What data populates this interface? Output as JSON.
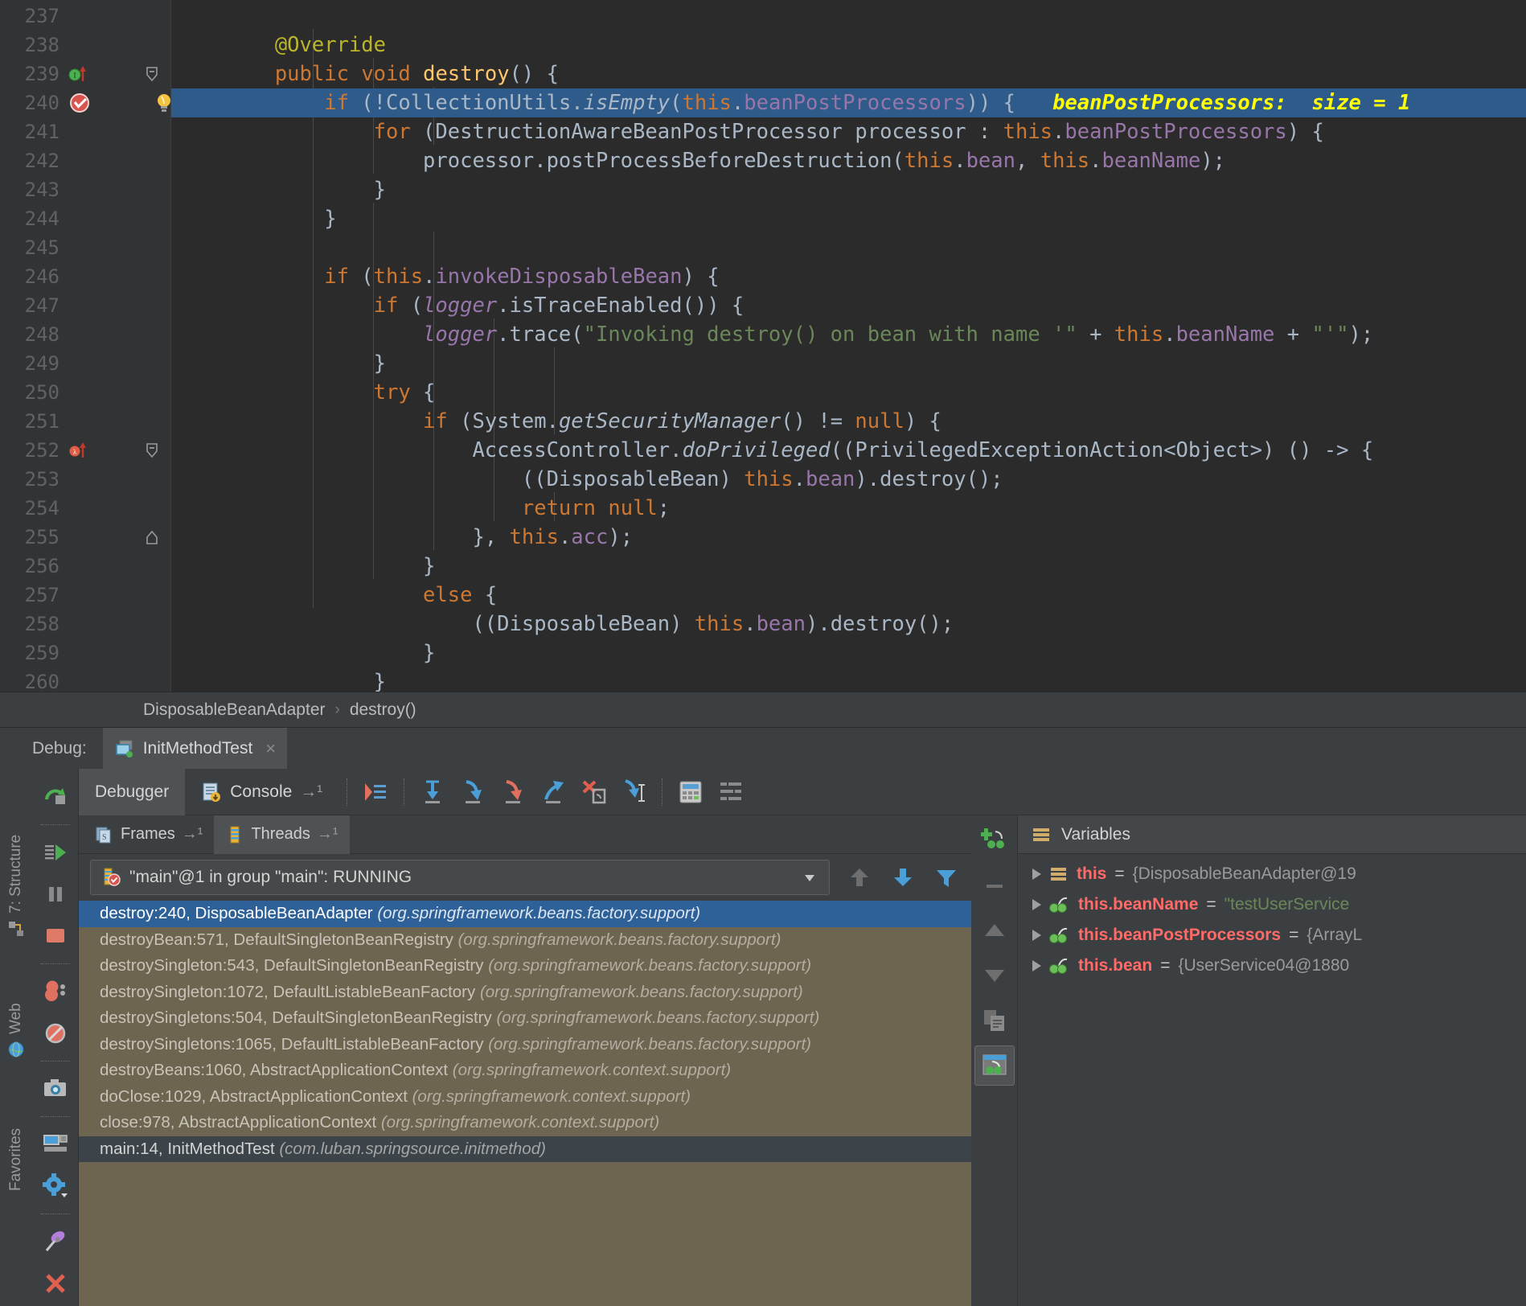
{
  "editor": {
    "first_line": 237,
    "highlight_line": 240,
    "inline_hint": "beanPostProcessors:  size = 1",
    "lines": [
      {
        "n": 237,
        "tokens": []
      },
      {
        "n": 238,
        "tokens": [
          {
            "t": "        ",
            "c": "pln"
          },
          {
            "t": "@Override",
            "c": "ann"
          }
        ]
      },
      {
        "n": 239,
        "tokens": [
          {
            "t": "        ",
            "c": "pln"
          },
          {
            "t": "public",
            "c": "kw"
          },
          {
            "t": " ",
            "c": "pln"
          },
          {
            "t": "void",
            "c": "kw"
          },
          {
            "t": " ",
            "c": "pln"
          },
          {
            "t": "destroy",
            "c": "mth"
          },
          {
            "t": "() {",
            "c": "pln"
          }
        ]
      },
      {
        "n": 240,
        "tokens": [
          {
            "t": "            ",
            "c": "pln"
          },
          {
            "t": "if",
            "c": "kw"
          },
          {
            "t": " (!CollectionUtils.",
            "c": "pln"
          },
          {
            "t": "isEmpty",
            "c": "pln ital"
          },
          {
            "t": "(",
            "c": "pln"
          },
          {
            "t": "this",
            "c": "kw"
          },
          {
            "t": ".",
            "c": "pln"
          },
          {
            "t": "beanPostProcessors",
            "c": "fld"
          },
          {
            "t": ")) {",
            "c": "pln"
          }
        ]
      },
      {
        "n": 241,
        "tokens": [
          {
            "t": "                ",
            "c": "pln"
          },
          {
            "t": "for",
            "c": "kw"
          },
          {
            "t": " (DestructionAwareBeanPostProcessor processor : ",
            "c": "pln"
          },
          {
            "t": "this",
            "c": "kw"
          },
          {
            "t": ".",
            "c": "pln"
          },
          {
            "t": "beanPostProcessors",
            "c": "fld"
          },
          {
            "t": ") {",
            "c": "pln"
          }
        ]
      },
      {
        "n": 242,
        "tokens": [
          {
            "t": "                    processor.postProcessBeforeDestruction(",
            "c": "pln"
          },
          {
            "t": "this",
            "c": "kw"
          },
          {
            "t": ".",
            "c": "pln"
          },
          {
            "t": "bean",
            "c": "fld"
          },
          {
            "t": ", ",
            "c": "pln"
          },
          {
            "t": "this",
            "c": "kw"
          },
          {
            "t": ".",
            "c": "pln"
          },
          {
            "t": "beanName",
            "c": "fld"
          },
          {
            "t": ");",
            "c": "pln"
          }
        ]
      },
      {
        "n": 243,
        "tokens": [
          {
            "t": "                }",
            "c": "pln"
          }
        ]
      },
      {
        "n": 244,
        "tokens": [
          {
            "t": "            }",
            "c": "pln"
          }
        ]
      },
      {
        "n": 245,
        "tokens": []
      },
      {
        "n": 246,
        "tokens": [
          {
            "t": "            ",
            "c": "pln"
          },
          {
            "t": "if",
            "c": "kw"
          },
          {
            "t": " (",
            "c": "pln"
          },
          {
            "t": "this",
            "c": "kw"
          },
          {
            "t": ".",
            "c": "pln"
          },
          {
            "t": "invokeDisposableBean",
            "c": "fld"
          },
          {
            "t": ") {",
            "c": "pln"
          }
        ]
      },
      {
        "n": 247,
        "tokens": [
          {
            "t": "                ",
            "c": "pln"
          },
          {
            "t": "if",
            "c": "kw"
          },
          {
            "t": " (",
            "c": "pln"
          },
          {
            "t": "logger",
            "c": "fld ital"
          },
          {
            "t": ".isTraceEnabled()) {",
            "c": "pln"
          }
        ]
      },
      {
        "n": 248,
        "tokens": [
          {
            "t": "                    ",
            "c": "pln"
          },
          {
            "t": "logger",
            "c": "fld ital"
          },
          {
            "t": ".trace(",
            "c": "pln"
          },
          {
            "t": "\"Invoking destroy() on bean with name '\"",
            "c": "str"
          },
          {
            "t": " + ",
            "c": "pln"
          },
          {
            "t": "this",
            "c": "kw"
          },
          {
            "t": ".",
            "c": "pln"
          },
          {
            "t": "beanName",
            "c": "fld"
          },
          {
            "t": " + ",
            "c": "pln"
          },
          {
            "t": "\"'\"",
            "c": "str"
          },
          {
            "t": ");",
            "c": "pln"
          }
        ]
      },
      {
        "n": 249,
        "tokens": [
          {
            "t": "                }",
            "c": "pln"
          }
        ]
      },
      {
        "n": 250,
        "tokens": [
          {
            "t": "                ",
            "c": "pln"
          },
          {
            "t": "try",
            "c": "kw"
          },
          {
            "t": " {",
            "c": "pln"
          }
        ]
      },
      {
        "n": 251,
        "tokens": [
          {
            "t": "                    ",
            "c": "pln"
          },
          {
            "t": "if",
            "c": "kw"
          },
          {
            "t": " (System.",
            "c": "pln"
          },
          {
            "t": "getSecurityManager",
            "c": "pln ital"
          },
          {
            "t": "() != ",
            "c": "pln"
          },
          {
            "t": "null",
            "c": "kw"
          },
          {
            "t": ") {",
            "c": "pln"
          }
        ]
      },
      {
        "n": 252,
        "tokens": [
          {
            "t": "                        AccessController.",
            "c": "pln"
          },
          {
            "t": "doPrivileged",
            "c": "pln ital"
          },
          {
            "t": "((PrivilegedExceptionAction<Object>) () -> {",
            "c": "pln"
          }
        ]
      },
      {
        "n": 253,
        "tokens": [
          {
            "t": "                            ((DisposableBean) ",
            "c": "pln"
          },
          {
            "t": "this",
            "c": "kw"
          },
          {
            "t": ".",
            "c": "pln"
          },
          {
            "t": "bean",
            "c": "fld"
          },
          {
            "t": ").destroy();",
            "c": "pln"
          }
        ]
      },
      {
        "n": 254,
        "tokens": [
          {
            "t": "                            ",
            "c": "pln"
          },
          {
            "t": "return",
            "c": "kw"
          },
          {
            "t": " ",
            "c": "pln"
          },
          {
            "t": "null",
            "c": "kw"
          },
          {
            "t": ";",
            "c": "pln"
          }
        ]
      },
      {
        "n": 255,
        "tokens": [
          {
            "t": "                        }, ",
            "c": "pln"
          },
          {
            "t": "this",
            "c": "kw"
          },
          {
            "t": ".",
            "c": "pln"
          },
          {
            "t": "acc",
            "c": "fld"
          },
          {
            "t": ");",
            "c": "pln"
          }
        ]
      },
      {
        "n": 256,
        "tokens": [
          {
            "t": "                    }",
            "c": "pln"
          }
        ]
      },
      {
        "n": 257,
        "tokens": [
          {
            "t": "                    ",
            "c": "pln"
          },
          {
            "t": "else",
            "c": "kw"
          },
          {
            "t": " {",
            "c": "pln"
          }
        ]
      },
      {
        "n": 258,
        "tokens": [
          {
            "t": "                        ((DisposableBean) ",
            "c": "pln"
          },
          {
            "t": "this",
            "c": "kw"
          },
          {
            "t": ".",
            "c": "pln"
          },
          {
            "t": "bean",
            "c": "fld"
          },
          {
            "t": ").destroy();",
            "c": "pln"
          }
        ]
      },
      {
        "n": 259,
        "tokens": [
          {
            "t": "                    }",
            "c": "pln"
          }
        ]
      },
      {
        "n": 260,
        "tokens": [
          {
            "t": "                }",
            "c": "pln"
          }
        ]
      }
    ]
  },
  "breadcrumb": {
    "class": "DisposableBeanAdapter",
    "separator": "›",
    "method": "destroy()"
  },
  "debug_header": {
    "label": "Debug:",
    "run_config": "InitMethodTest",
    "close": "×"
  },
  "debug_toolbar": {
    "tabs": [
      {
        "label": "Debugger",
        "active": true
      },
      {
        "label": "Console",
        "active": false,
        "suffix": "→¹"
      }
    ],
    "actions": [
      "show-execution-point-icon",
      "step-over-icon",
      "step-into-icon",
      "force-step-into-icon",
      "step-out-icon",
      "drop-frame-icon",
      "run-to-cursor-icon",
      "evaluate-expression-icon",
      "settings-icon"
    ]
  },
  "frames_panel": {
    "tabs": [
      {
        "label": "Frames",
        "suffix": "→¹",
        "active": false
      },
      {
        "label": "Threads",
        "suffix": "→¹",
        "active": true
      }
    ],
    "thread_selector": {
      "value": "\"main\"@1 in group \"main\": RUNNING",
      "icon": "thread-running-icon"
    },
    "thread_tools": [
      "frame-up-icon",
      "frame-down-icon",
      "filter-icon"
    ],
    "frames": [
      {
        "method": "destroy:240, DisposableBeanAdapter",
        "pkg": "(org.springframework.beans.factory.support)",
        "state": "selected"
      },
      {
        "method": "destroyBean:571, DefaultSingletonBeanRegistry",
        "pkg": "(org.springframework.beans.factory.support)",
        "state": "lib"
      },
      {
        "method": "destroySingleton:543, DefaultSingletonBeanRegistry",
        "pkg": "(org.springframework.beans.factory.support)",
        "state": "lib"
      },
      {
        "method": "destroySingleton:1072, DefaultListableBeanFactory",
        "pkg": "(org.springframework.beans.factory.support)",
        "state": "lib"
      },
      {
        "method": "destroySingletons:504, DefaultSingletonBeanRegistry",
        "pkg": "(org.springframework.beans.factory.support)",
        "state": "lib"
      },
      {
        "method": "destroySingletons:1065, DefaultListableBeanFactory",
        "pkg": "(org.springframework.beans.factory.support)",
        "state": "lib"
      },
      {
        "method": "destroyBeans:1060, AbstractApplicationContext",
        "pkg": "(org.springframework.context.support)",
        "state": "lib"
      },
      {
        "method": "doClose:1029, AbstractApplicationContext",
        "pkg": "(org.springframework.context.support)",
        "state": "lib"
      },
      {
        "method": "close:978, AbstractApplicationContext",
        "pkg": "(org.springframework.context.support)",
        "state": "lib"
      },
      {
        "method": "main:14, InitMethodTest",
        "pkg": "(com.luban.springsource.initmethod)",
        "state": "user"
      }
    ]
  },
  "variables_panel": {
    "title": "Variables",
    "tools": [
      "add-watch-icon",
      "remove-watch-icon",
      "move-up-icon",
      "move-down-icon",
      "copy-icon",
      "inline-watches-icon"
    ],
    "rows": [
      {
        "name": "this",
        "eq": "=",
        "value": "{DisposableBeanAdapter@19",
        "icon": "object-icon",
        "string": false
      },
      {
        "name": "this.beanName",
        "eq": "=",
        "value": "\"testUserService",
        "icon": "field-icon",
        "string": true
      },
      {
        "name": "this.beanPostProcessors",
        "eq": "=",
        "value": "{ArrayL",
        "icon": "field-icon",
        "string": false
      },
      {
        "name": "this.bean",
        "eq": "=",
        "value": "{UserService04@1880",
        "icon": "field-icon",
        "string": false
      }
    ]
  },
  "left_rail": {
    "labels": [
      "7: Structure",
      "Web",
      "Favorites"
    ]
  },
  "debug_actions_column": [
    "rerun-icon",
    "resume-program-icon",
    "pause-program-icon",
    "stop-icon",
    "view-breakpoints-icon",
    "mute-breakpoints-icon",
    "get-thread-dump-icon",
    "restore-layout-icon",
    "settings-gear-icon",
    "pin-tab-icon",
    "close-icon"
  ],
  "colors": {
    "editor_bg": "#2b2b2b",
    "gutter_bg": "#313335",
    "panel_bg": "#3c3f41",
    "selection": "#2f6199",
    "frames_bg": "#6e6550",
    "accent_yellow": "#ffff00",
    "var_name": "#ff6b68",
    "string_green": "#6a8759"
  }
}
